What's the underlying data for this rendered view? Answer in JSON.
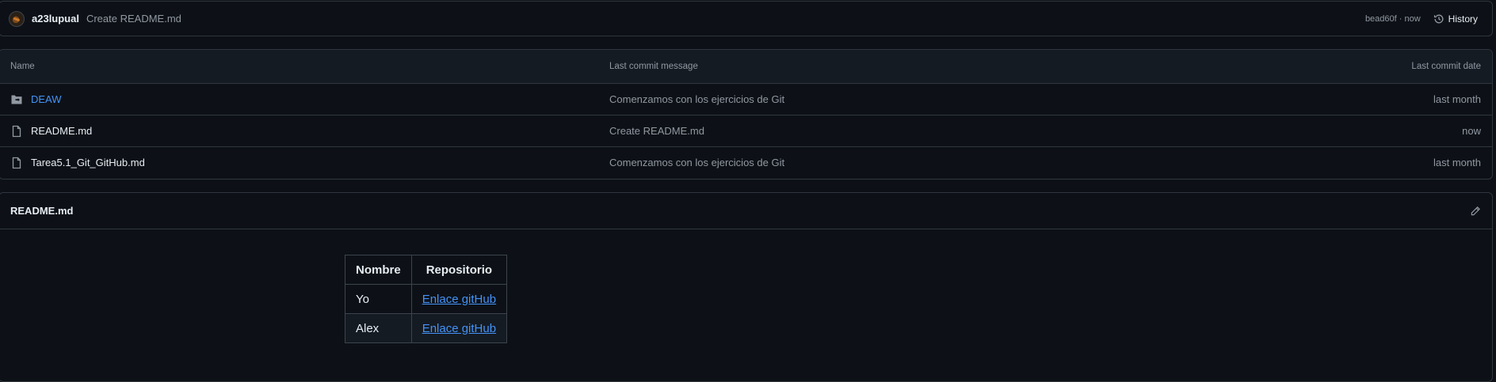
{
  "commit": {
    "author": "a23lupual",
    "message": "Create README.md",
    "meta": "bead60f · now",
    "history_label": "History"
  },
  "files": {
    "headers": {
      "name": "Name",
      "message": "Last commit message",
      "date": "Last commit date"
    },
    "rows": [
      {
        "name": "DEAW",
        "type": "folder",
        "message": "Comenzamos con los ejercicios de Git",
        "date": "last month"
      },
      {
        "name": "README.md",
        "type": "file",
        "message": "Create README.md",
        "date": "now"
      },
      {
        "name": "Tarea5.1_Git_GitHub.md",
        "type": "file",
        "message": "Comenzamos con los ejercicios de Git",
        "date": "last month"
      }
    ]
  },
  "readme": {
    "title": "README.md",
    "table": {
      "headers": [
        "Nombre",
        "Repositorio"
      ],
      "rows": [
        {
          "name": "Yo",
          "link": "Enlace gitHub"
        },
        {
          "name": "Alex",
          "link": "Enlace gitHub"
        }
      ]
    }
  },
  "colors": {
    "background": "#0d1117",
    "border": "#30363d",
    "link": "#4493f8",
    "muted": "#9198a1"
  },
  "icons": {
    "folder": "file-directory-icon",
    "file": "file-icon",
    "history": "history-icon",
    "edit": "pencil-icon"
  }
}
